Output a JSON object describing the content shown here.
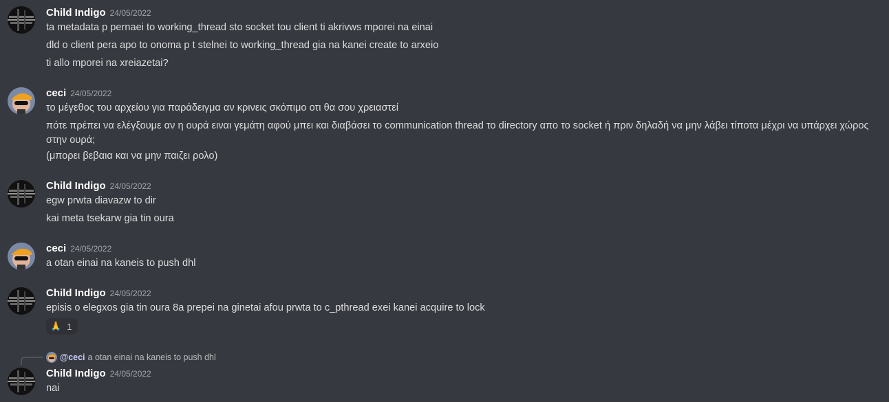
{
  "users": {
    "child": "Child Indigo",
    "ceci": "ceci"
  },
  "messages": [
    {
      "author": "Child Indigo",
      "timestamp": "24/05/2022",
      "lines": [
        "ta metadata p pernaei to working_thread sto socket tou client ti akrivws mporei na einai",
        "dld o client pera apo to onoma p t stelnei to working_thread gia na kanei create to arxeio",
        "ti allo mporei na xreiazetai?"
      ]
    },
    {
      "author": "ceci",
      "timestamp": "24/05/2022",
      "lines": [
        "το μέγεθος του αρχείου για παράδειγμα αν κρινεις σκόπιμο οτι θα σου χρειαστεί",
        "πότε πρέπει να ελέγξουμε αν η ουρά ειναι γεμάτη αφού μπει και διαβάσει το communication thread το directory απο το socket ή πριν δηλαδή να μην λάβει τίποτα μέχρι να υπάρχει χώρος στην ουρά;",
        "(μπορει βεβαια και να μην παιζει ρολο)"
      ]
    },
    {
      "author": "Child Indigo",
      "timestamp": "24/05/2022",
      "lines": [
        "egw prwta diavazw to dir",
        "kai meta tsekarw gia tin oura"
      ]
    },
    {
      "author": "ceci",
      "timestamp": "24/05/2022",
      "lines": [
        "a otan einai na kaneis to push dhl"
      ]
    },
    {
      "author": "Child Indigo",
      "timestamp": "24/05/2022",
      "lines": [
        "episis o elegxos gia tin oura 8a prepei na ginetai afou prwta to c_pthread exei kanei acquire to lock"
      ],
      "reaction": {
        "emoji": "🙏",
        "count": "1"
      }
    },
    {
      "author": "Child Indigo",
      "timestamp": "24/05/2022",
      "reply": {
        "mention": "@ceci",
        "text": "a otan einai na kaneis to push dhl"
      },
      "lines": [
        "nai"
      ]
    }
  ],
  "avatars": {
    "child": "dark-noise-avatar",
    "ceci": "orange-hat-sunglasses-avatar"
  },
  "colors": {
    "background": "#36393f",
    "username": "#ffffff",
    "timestamp": "#a3a6aa",
    "text": "#dcddde",
    "mention": "#c9cdfb"
  }
}
